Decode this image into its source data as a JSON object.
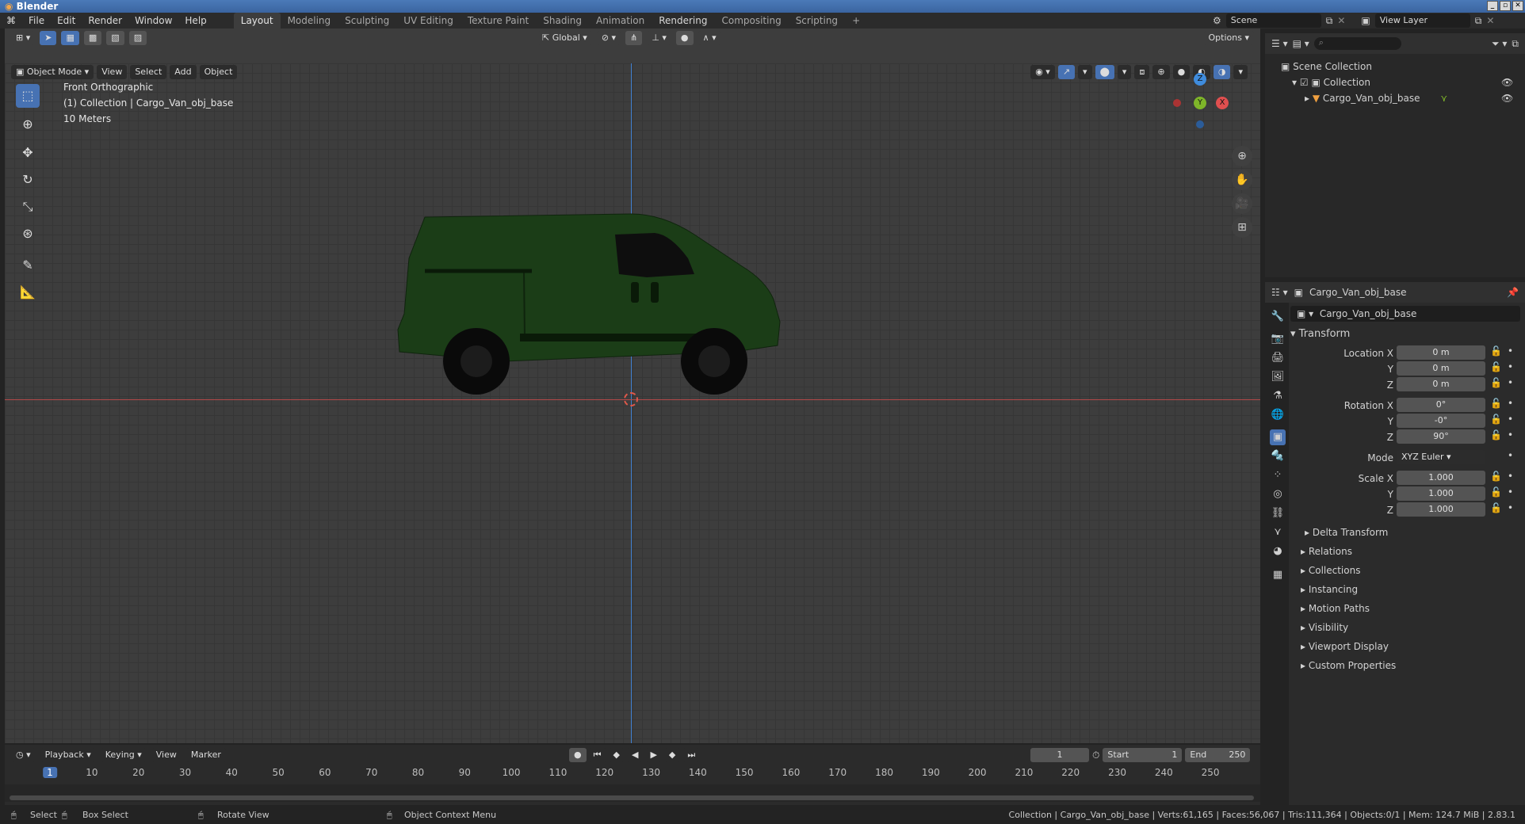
{
  "app": {
    "title": "Blender"
  },
  "menu": [
    "File",
    "Edit",
    "Render",
    "Window",
    "Help"
  ],
  "workspaces": [
    "Layout",
    "Modeling",
    "Sculpting",
    "UV Editing",
    "Texture Paint",
    "Shading",
    "Animation",
    "Rendering",
    "Compositing",
    "Scripting"
  ],
  "active_workspace": "Layout",
  "scene_name": "Scene",
  "view_layer": "View Layer",
  "viewport": {
    "mode": "Object Mode",
    "menus": [
      "View",
      "Select",
      "Add",
      "Object"
    ],
    "orientation": "Global",
    "options": "Options",
    "view_name": "Front Orthographic",
    "collection_info": "(1) Collection | Cargo_Van_obj_base",
    "scale_info": "10 Meters"
  },
  "gizmo": {
    "z": "Z",
    "y": "Y",
    "x": "X"
  },
  "outliner": {
    "root": "Scene Collection",
    "collection": "Collection",
    "object": "Cargo_Van_obj_base"
  },
  "properties": {
    "object_header": "Cargo_Van_obj_base",
    "object_name": "Cargo_Van_obj_base",
    "transform_title": "Transform",
    "location_label": "Location X",
    "loc_x": "0 m",
    "loc_y": "0 m",
    "loc_z": "0 m",
    "rotation_label": "Rotation X",
    "rot_x": "0°",
    "rot_y": "-0°",
    "rot_z": "90°",
    "mode_label": "Mode",
    "mode_value": "XYZ Euler",
    "scale_label": "Scale X",
    "scale_x": "1.000",
    "scale_y": "1.000",
    "scale_z": "1.000",
    "y_label": "Y",
    "z_label": "Z",
    "delta_transform": "Delta Transform",
    "panels": [
      "Relations",
      "Collections",
      "Instancing",
      "Motion Paths",
      "Visibility",
      "Viewport Display",
      "Custom Properties"
    ]
  },
  "timeline": {
    "menus": [
      "Playback",
      "Keying",
      "View",
      "Marker"
    ],
    "current_frame": "1",
    "start_label": "Start",
    "start_value": "1",
    "end_label": "End",
    "end_value": "250",
    "ticks": [
      "1",
      "10",
      "20",
      "30",
      "40",
      "50",
      "60",
      "70",
      "80",
      "90",
      "100",
      "110",
      "120",
      "130",
      "140",
      "150",
      "160",
      "170",
      "180",
      "190",
      "200",
      "210",
      "220",
      "230",
      "240",
      "250"
    ]
  },
  "statusbar": {
    "select": "Select",
    "box_select": "Box Select",
    "rotate_view": "Rotate View",
    "context_menu": "Object Context Menu",
    "stats": "Collection | Cargo_Van_obj_base | Verts:61,165 | Faces:56,067 | Tris:111,364 | Objects:0/1 | Mem: 124.7 MiB | 2.83.1"
  },
  "colors": {
    "accent": "#4772b3",
    "x_axis": "#e04f4f",
    "y_axis": "#7eb529",
    "z_axis": "#3f8cdd",
    "van": "#1b3d17"
  }
}
